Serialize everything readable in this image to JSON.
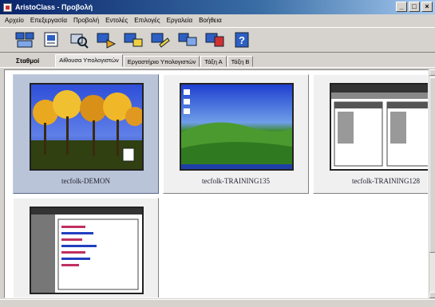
{
  "window": {
    "title": "AristoClass - Προβολή",
    "buttons": {
      "minimize": "_",
      "maximize": "□",
      "close": "×"
    }
  },
  "menu": [
    "Αρχείο",
    "Επεξεργασία",
    "Προβολή",
    "Εντολές",
    "Επιλογές",
    "Εργαλεία",
    "Βοήθεια"
  ],
  "toolbar": {
    "icons": [
      "view-group-icon",
      "notes-icon",
      "search-station-icon",
      "send-file-icon",
      "message-icon",
      "lock-station-icon",
      "show-screen-icon",
      "broadcast-icon",
      "help-icon"
    ]
  },
  "tabs": {
    "caption": "Σταθμοί",
    "items": [
      {
        "label": "Αίθουσα Υπολογιστών",
        "active": true
      },
      {
        "label": "Εργαστήριο Υπολογιστών",
        "active": false
      },
      {
        "label": "Τάξη Α",
        "active": false
      },
      {
        "label": "Τάξη Β",
        "active": false
      }
    ]
  },
  "stations": [
    {
      "name": "tecfolk-DEMON",
      "selected": true,
      "screen": "trees"
    },
    {
      "name": "tecfolk-TRAINING135",
      "selected": false,
      "screen": "bliss"
    },
    {
      "name": "tecfolk-TRAINING128",
      "selected": false,
      "screen": "desk"
    },
    {
      "name": "",
      "selected": false,
      "screen": "app"
    }
  ]
}
